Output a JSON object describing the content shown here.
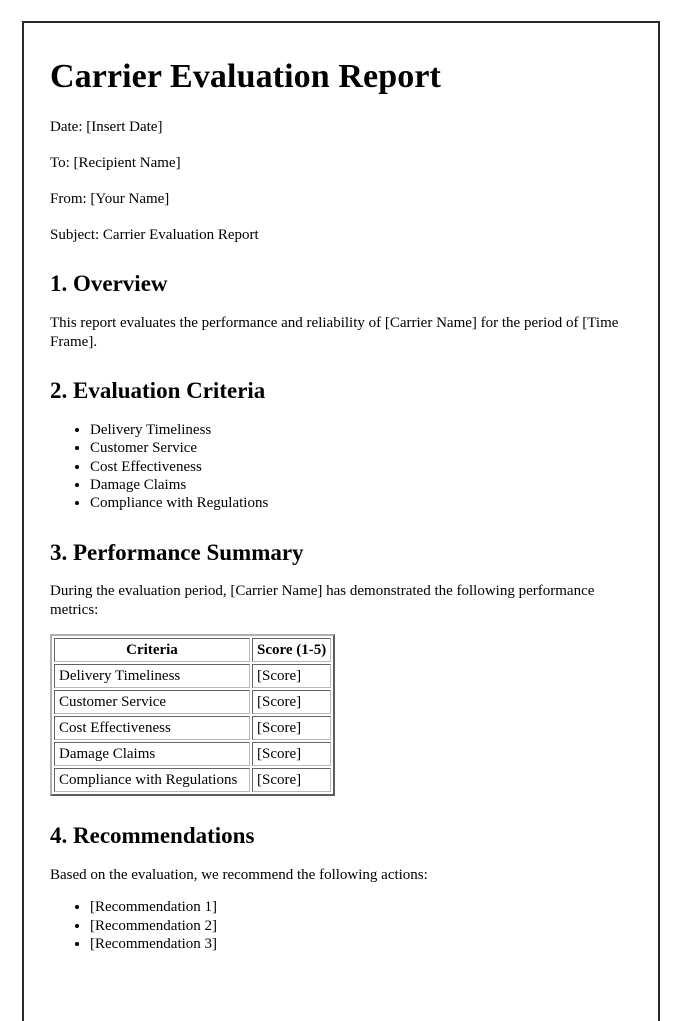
{
  "document": {
    "title": "Carrier Evaluation Report",
    "meta": [
      "Date: [Insert Date]",
      "To: [Recipient Name]",
      "From: [Your Name]",
      "Subject: Carrier Evaluation Report"
    ],
    "sections": {
      "overview": {
        "heading": "1. Overview",
        "paragraph": "This report evaluates the performance and reliability of [Carrier Name] for the period of [Time Frame]."
      },
      "criteria": {
        "heading": "2. Evaluation Criteria",
        "items": [
          "Delivery Timeliness",
          "Customer Service",
          "Cost Effectiveness",
          "Damage Claims",
          "Compliance with Regulations"
        ]
      },
      "performance": {
        "heading": "3. Performance Summary",
        "paragraph": "During the evaluation period, [Carrier Name] has demonstrated the following performance metrics:",
        "table": {
          "headers": [
            "Criteria",
            "Score (1-5)"
          ],
          "rows": [
            [
              "Delivery Timeliness",
              "[Score]"
            ],
            [
              "Customer Service",
              "[Score]"
            ],
            [
              "Cost Effectiveness",
              "[Score]"
            ],
            [
              "Damage Claims",
              "[Score]"
            ],
            [
              "Compliance with Regulations",
              "[Score]"
            ]
          ]
        }
      },
      "recommendations": {
        "heading": "4. Recommendations",
        "paragraph": "Based on the evaluation, we recommend the following actions:",
        "items": [
          "[Recommendation 1]",
          "[Recommendation 2]",
          "[Recommendation 3]"
        ]
      }
    }
  },
  "colors": {
    "page_border": "#2b2b2b",
    "text": "#000000",
    "table_border": "#b8b8b8",
    "background": "#ffffff"
  }
}
